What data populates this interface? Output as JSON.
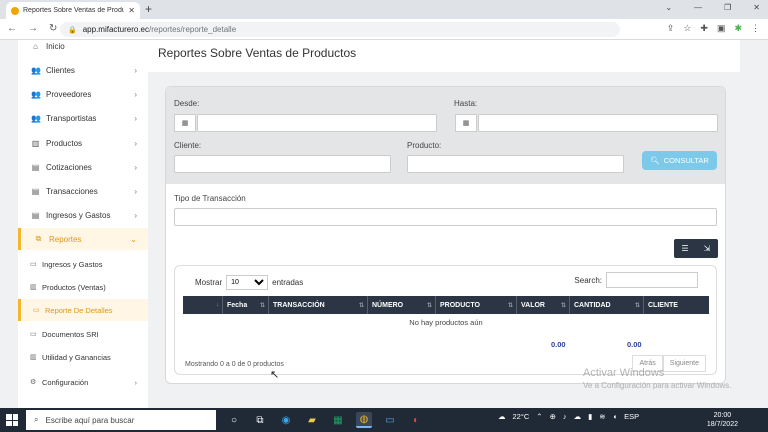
{
  "browser": {
    "tab_title": "Reportes Sobre Ventas de Produc",
    "url_host": "app.mifacturero.ec",
    "url_path": "/reportes/reporte_detalle"
  },
  "sidebar": {
    "items": [
      {
        "label": "Inicio",
        "icon": "home-icon"
      },
      {
        "label": "Clientes",
        "icon": "users-icon"
      },
      {
        "label": "Proveedores",
        "icon": "users-icon"
      },
      {
        "label": "Transportistas",
        "icon": "users-icon"
      },
      {
        "label": "Productos",
        "icon": "bars-icon"
      },
      {
        "label": "Cotizaciones",
        "icon": "list-icon"
      },
      {
        "label": "Transacciones",
        "icon": "list-icon"
      },
      {
        "label": "Ingresos y Gastos",
        "icon": "list-icon"
      },
      {
        "label": "Reportes",
        "icon": "copy-icon"
      }
    ],
    "sub_items": [
      {
        "label": "Ingresos y Gastos"
      },
      {
        "label": "Productos (Ventas)"
      },
      {
        "label": "Reporte De Detalles"
      },
      {
        "label": "Documentos SRI"
      },
      {
        "label": "Utilidad y Ganancias"
      },
      {
        "label": "Configuración"
      }
    ]
  },
  "page": {
    "title": "Reportes Sobre Ventas de Productos"
  },
  "filters": {
    "desde_label": "Desde:",
    "hasta_label": "Hasta:",
    "cliente_label": "Cliente:",
    "producto_label": "Producto:",
    "tipo_label": "Tipo de Transacción",
    "consultar_label": "CONSULTAR"
  },
  "table": {
    "show_label": "Mostrar",
    "entries_label": "entradas",
    "page_size": "10",
    "search_label": "Search:",
    "columns": [
      "",
      "Fecha",
      "TRANSACCIÓN",
      "NÚMERO",
      "PRODUCTO",
      "VALOR",
      "CANTIDAD",
      "CLIENTE"
    ],
    "empty_text": "No hay productos aún",
    "total_valor": "0.00",
    "total_cantidad": "0.00",
    "info_text": "Mostrando 0 a 0 de 0 productos",
    "prev_label": "Atrás",
    "next_label": "Siguiente"
  },
  "watermark": {
    "line1": "Activar Windows",
    "line2": "Ve a Configuración para activar Windows."
  },
  "taskbar": {
    "search_placeholder": "Escribe aquí para buscar",
    "temperature": "22°C",
    "language": "ESP",
    "time": "20:00",
    "date": "18/7/2022"
  },
  "colors": {
    "accent": "#f5b52c",
    "table_header": "#2b3544",
    "consultar_button": "#7cc9ea",
    "total_text": "#2c3e9f"
  }
}
